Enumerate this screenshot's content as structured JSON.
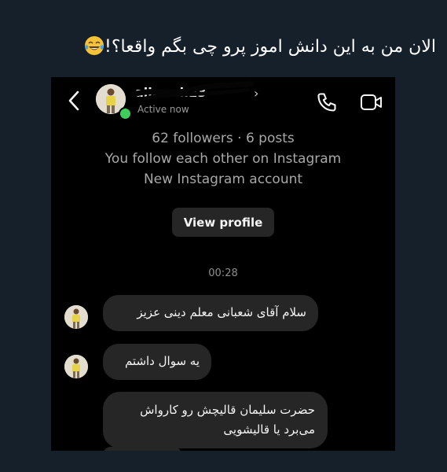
{
  "tweet": {
    "text": "الان من به این دانش اموز پرو چی بگم واقعا؟!",
    "emoji": "face-with-tears-of-joy"
  },
  "dm": {
    "header": {
      "username": "ali...mi.23",
      "status": "Active now"
    },
    "profile": {
      "stats": "62 followers · 6 posts",
      "mutual": "You follow each other on Instagram",
      "account_note": "New Instagram account",
      "view_profile_label": "View profile"
    },
    "timestamp": "00:28",
    "messages": [
      {
        "text": "سلام آقای شعبانی معلم دینی عزیز",
        "sender_avatar": true
      },
      {
        "text": "یه سوال داشتم",
        "sender_avatar": true
      },
      {
        "text_line1": "حضرت سلیمان قالیچش رو کارواش",
        "text_line2": "می‌برد یا قالیشویی",
        "sender_avatar": false
      }
    ]
  }
}
